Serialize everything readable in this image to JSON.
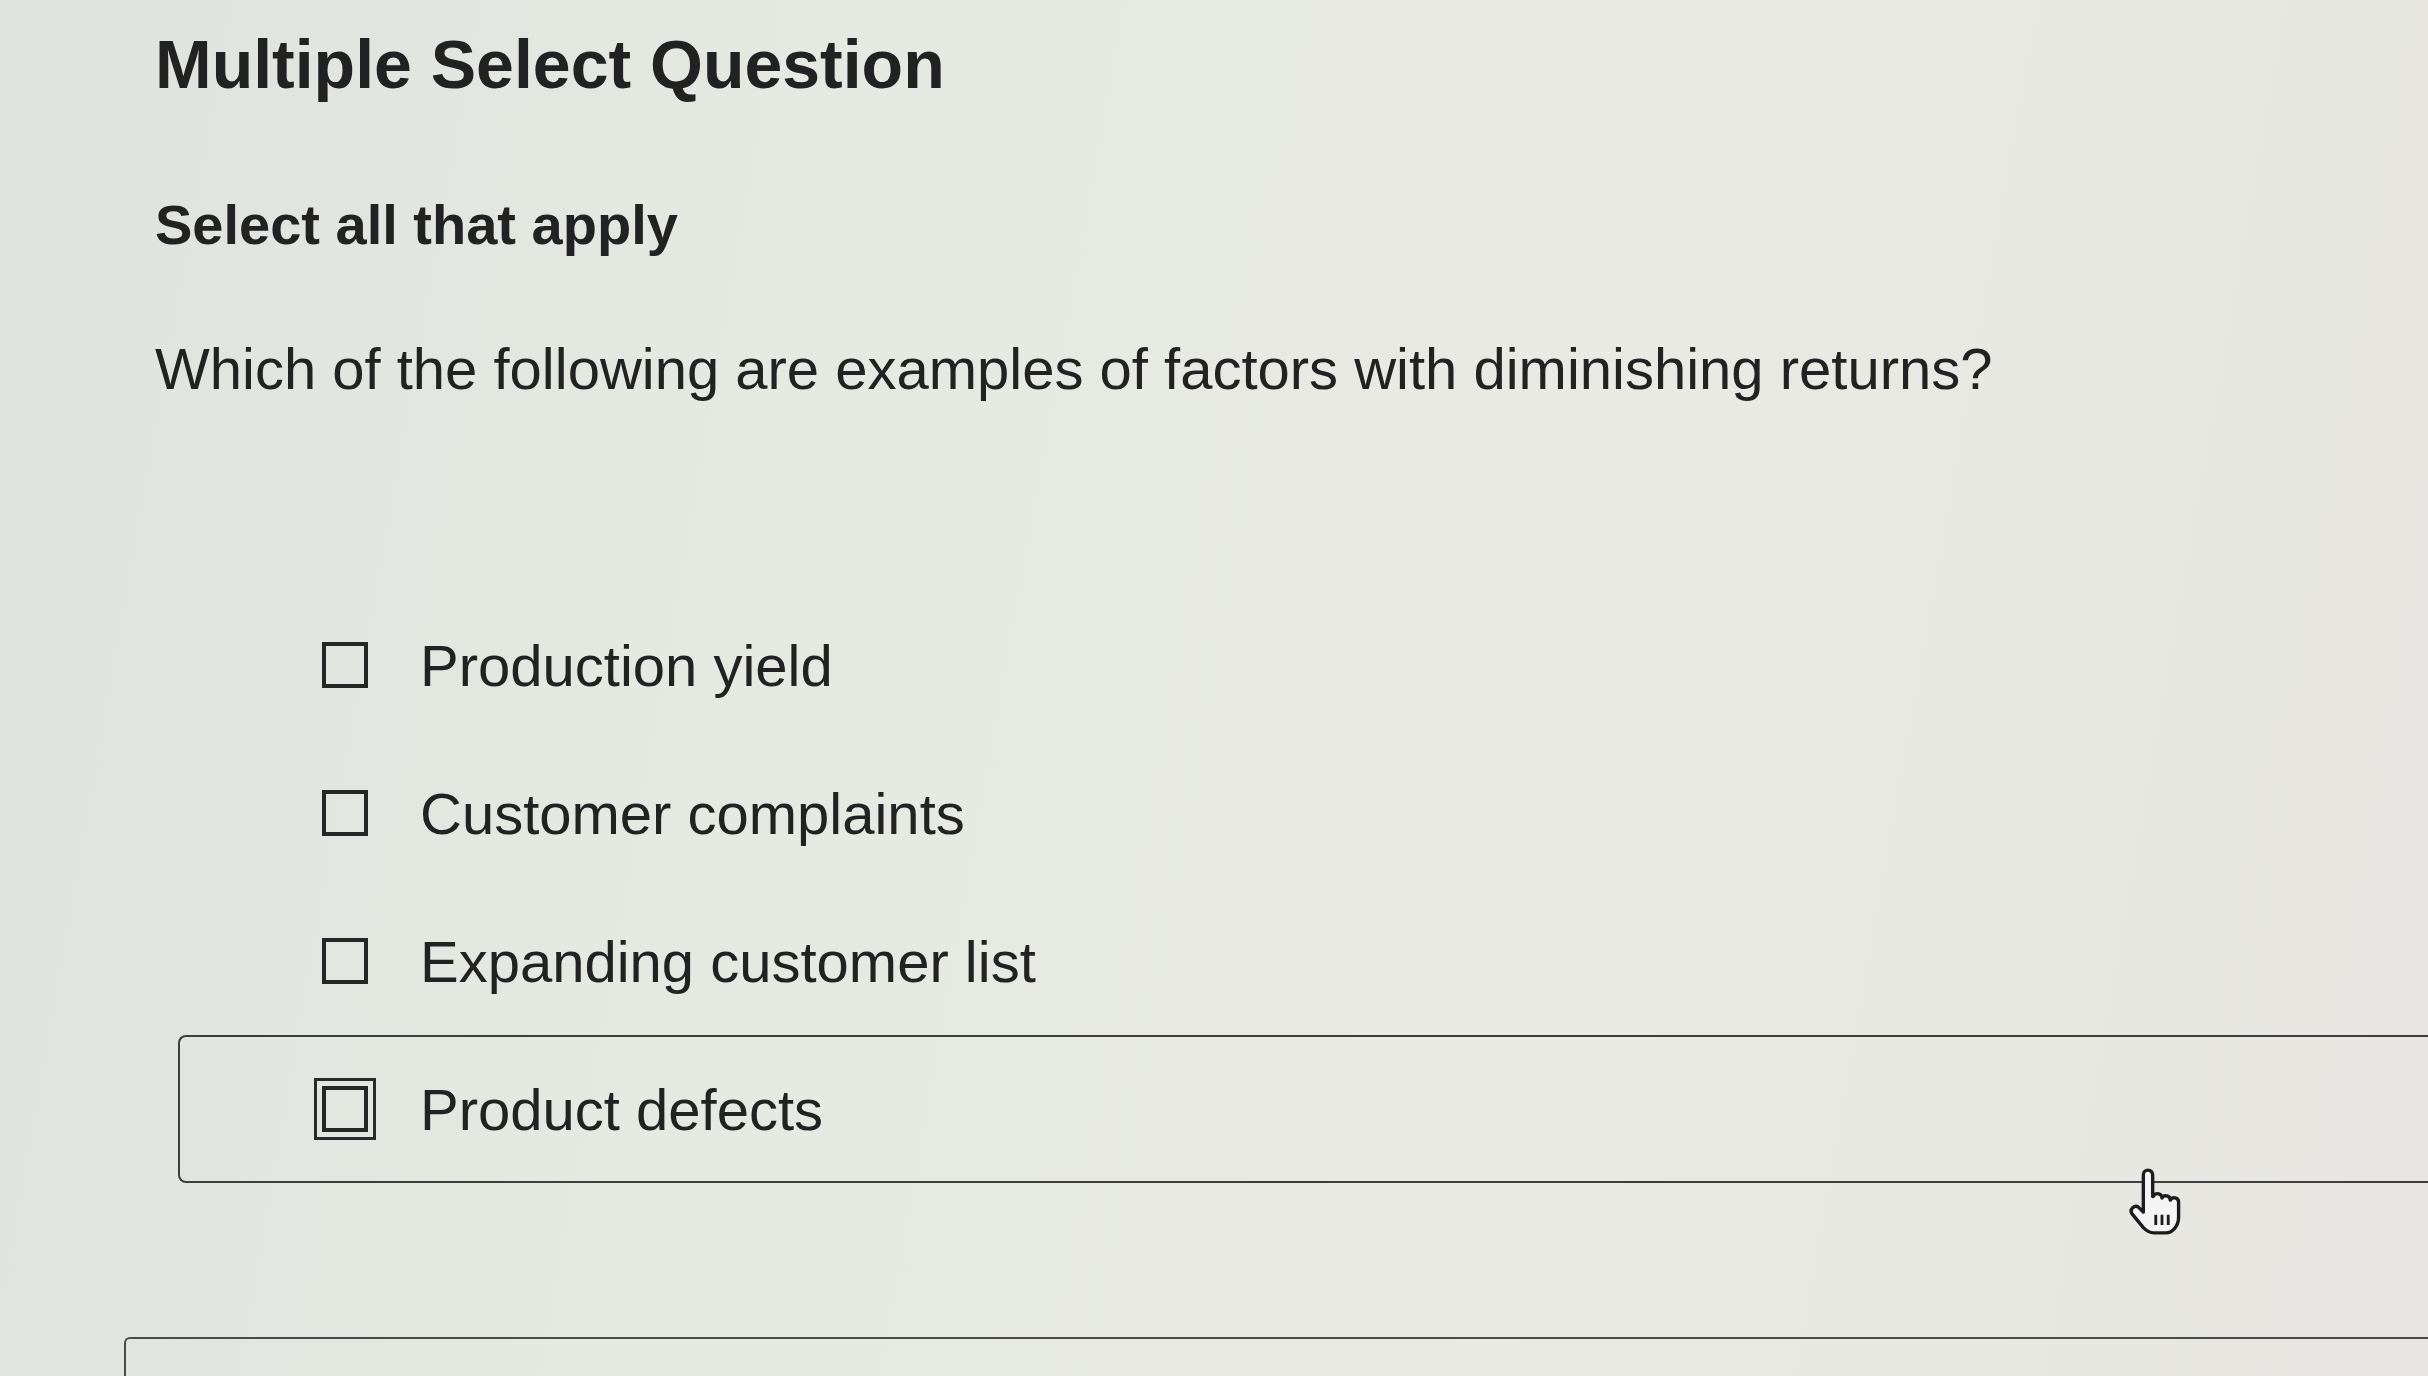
{
  "header": {
    "title": "Multiple Select Question"
  },
  "instruction": "Select all that apply",
  "question": "Which of the following are examples of factors with diminishing returns?",
  "options": [
    {
      "label": "Production yield",
      "checked": false,
      "focused": false
    },
    {
      "label": "Customer complaints",
      "checked": false,
      "focused": false
    },
    {
      "label": "Expanding customer list",
      "checked": false,
      "focused": false
    },
    {
      "label": "Product defects",
      "checked": false,
      "focused": true
    }
  ]
}
